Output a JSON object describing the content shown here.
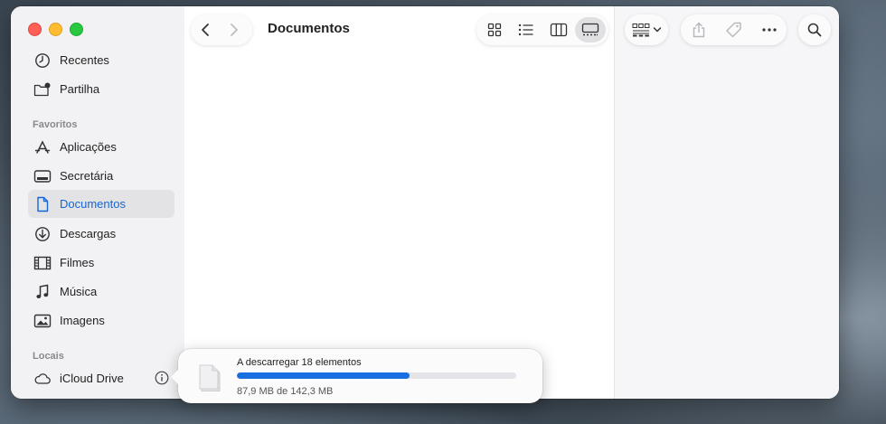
{
  "window": {
    "title": "Documentos"
  },
  "sidebar": {
    "top_items": [
      {
        "label": "Recentes",
        "icon": "clock-icon"
      },
      {
        "label": "Partilha",
        "icon": "shared-folder-icon"
      }
    ],
    "favorites_label": "Favoritos",
    "favorites": [
      {
        "label": "Aplicações",
        "icon": "applications-icon"
      },
      {
        "label": "Secretária",
        "icon": "desktop-icon"
      },
      {
        "label": "Documentos",
        "icon": "document-icon",
        "active": true
      },
      {
        "label": "Descargas",
        "icon": "download-icon"
      },
      {
        "label": "Filmes",
        "icon": "film-icon"
      },
      {
        "label": "Música",
        "icon": "music-icon"
      },
      {
        "label": "Imagens",
        "icon": "photo-icon"
      }
    ],
    "locations_label": "Locais",
    "locations": [
      {
        "label": "iCloud Drive",
        "icon": "cloud-icon"
      }
    ]
  },
  "colors": {
    "accent": "#1466d6",
    "progress": "#1a6fe0"
  },
  "download": {
    "title": "A descarregar 18 elementos",
    "status": "87,9 MB de 142,3 MB",
    "progress": 0.618
  }
}
